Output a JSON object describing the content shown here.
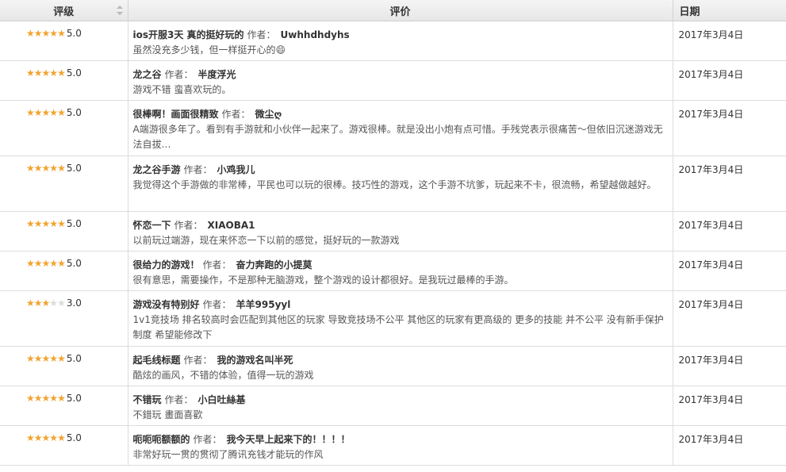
{
  "header": {
    "rating": "评级",
    "review": "评价",
    "date": "日期"
  },
  "author_label": "作者：",
  "colors": {
    "star_on": "#f0a431",
    "star_off": "#dcdcdc"
  },
  "rows": [
    {
      "stars": 5,
      "score": "5.0",
      "title": "ios开服3天 真的挺好玩的",
      "author": "Uwhhdhdyhs",
      "body": "虽然没充多少钱，但一样挺开心的😄",
      "date": "2017年3月4日"
    },
    {
      "stars": 5,
      "score": "5.0",
      "title": "龙之谷",
      "author": "半度浮光",
      "body": "游戏不错 蛮喜欢玩的。",
      "date": "2017年3月4日"
    },
    {
      "stars": 5,
      "score": "5.0",
      "title": "很棒啊！画面很精致",
      "author": "微尘ღ",
      "body": "A端游很多年了。看到有手游就和小伙伴一起来了。游戏很棒。就是没出小炮有点可惜。手残党表示很痛苦～但依旧沉迷游戏无法自拔…",
      "date": "2017年3月4日"
    },
    {
      "stars": 5,
      "score": "5.0",
      "title": "龙之谷手游",
      "author": "小鸡我儿",
      "body": "我觉得这个手游做的非常棒，平民也可以玩的很棒。技巧性的游戏，这个手游不坑爹，玩起来不卡，很流畅，希望越做越好。",
      "date": "2017年3月4日"
    },
    {
      "stars": 5,
      "score": "5.0",
      "title": "怀恋一下",
      "author": "XIAOBA1",
      "body": "以前玩过端游，现在来怀恋一下以前的感觉，挺好玩的一款游戏",
      "date": "2017年3月4日"
    },
    {
      "stars": 5,
      "score": "5.0",
      "title": "很给力的游戏！",
      "author": "奋力奔跑的小提莫",
      "body": "很有意思，需要操作，不是那种无脑游戏，整个游戏的设计都很好。是我玩过最棒的手游。",
      "date": "2017年3月4日"
    },
    {
      "stars": 3,
      "score": "3.0",
      "title": "游戏没有特别好",
      "author": "羊羊995yyl",
      "body": "1v1竞技场 排名较高时会匹配到其他区的玩家 导致竞技场不公平 其他区的玩家有更高级的 更多的技能 并不公平 没有新手保护制度 希望能修改下",
      "date": "2017年3月4日"
    },
    {
      "stars": 5,
      "score": "5.0",
      "title": "起毛线标题",
      "author": "我的游戏名叫半死",
      "body": "酷炫的画风，不错的体验，值得一玩的游戏",
      "date": "2017年3月4日"
    },
    {
      "stars": 5,
      "score": "5.0",
      "title": "不错玩",
      "author": "小白吐絲基",
      "body": "不錯玩 畫面喜歡",
      "date": "2017年3月4日"
    },
    {
      "stars": 5,
      "score": "5.0",
      "title": "呃呃呃额额的",
      "author": "我今天早上起来下的！！！！",
      "body": "非常好玩一贯的贯彻了腾讯充钱才能玩的作风",
      "date": "2017年3月4日"
    }
  ]
}
